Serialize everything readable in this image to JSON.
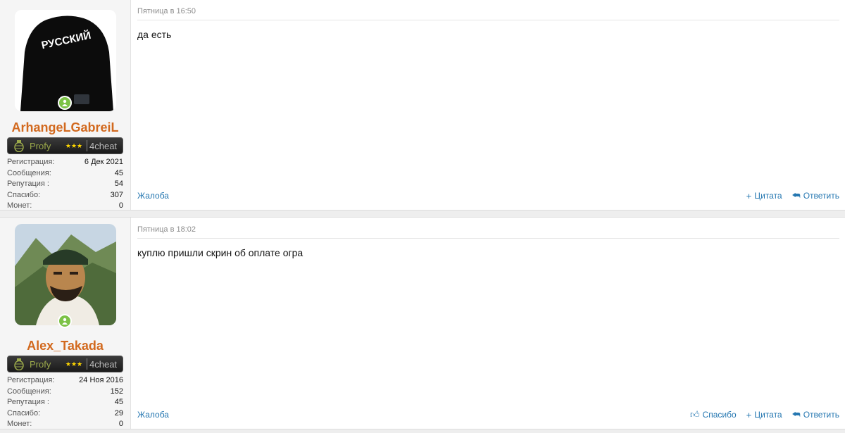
{
  "posts": [
    {
      "username": "ArhangeLGabreiL",
      "avatar_text": "РУССКИЙ",
      "banner": {
        "rank": "Profy",
        "stars": "★★★",
        "site": "4cheat"
      },
      "stats": [
        {
          "k": "Регистрация:",
          "v": "6 Дек 2021"
        },
        {
          "k": "Сообщения:",
          "v": "45"
        },
        {
          "k": "Репутация :",
          "v": "54"
        },
        {
          "k": "Спасибо:",
          "v": "307"
        },
        {
          "k": "Монет:",
          "v": "0"
        }
      ],
      "date": "Пятница в 16:50",
      "message": "да есть",
      "report": "Жалоба",
      "actions": {
        "quote": "Цитата",
        "reply": "Ответить"
      }
    },
    {
      "username": "Alex_Takada",
      "banner": {
        "rank": "Profy",
        "stars": "★★★",
        "site": "4cheat"
      },
      "stats": [
        {
          "k": "Регистрация:",
          "v": "24 Ноя 2016"
        },
        {
          "k": "Сообщения:",
          "v": "152"
        },
        {
          "k": "Репутация :",
          "v": "45"
        },
        {
          "k": "Спасибо:",
          "v": "29"
        },
        {
          "k": "Монет:",
          "v": "0"
        }
      ],
      "date": "Пятница в 18:02",
      "message": "куплю пришли скрин об оплате огра",
      "report": "Жалоба",
      "actions": {
        "like": "Спасибо",
        "quote": "Цитата",
        "reply": "Ответить"
      }
    }
  ],
  "colors": {
    "username": "#d2691e",
    "link": "#2577b1",
    "online": "#7cc246"
  },
  "icons": {
    "online": "user-online-icon",
    "like": "thumbs-up-icon",
    "quote": "plus-icon",
    "reply": "reply-icon"
  }
}
